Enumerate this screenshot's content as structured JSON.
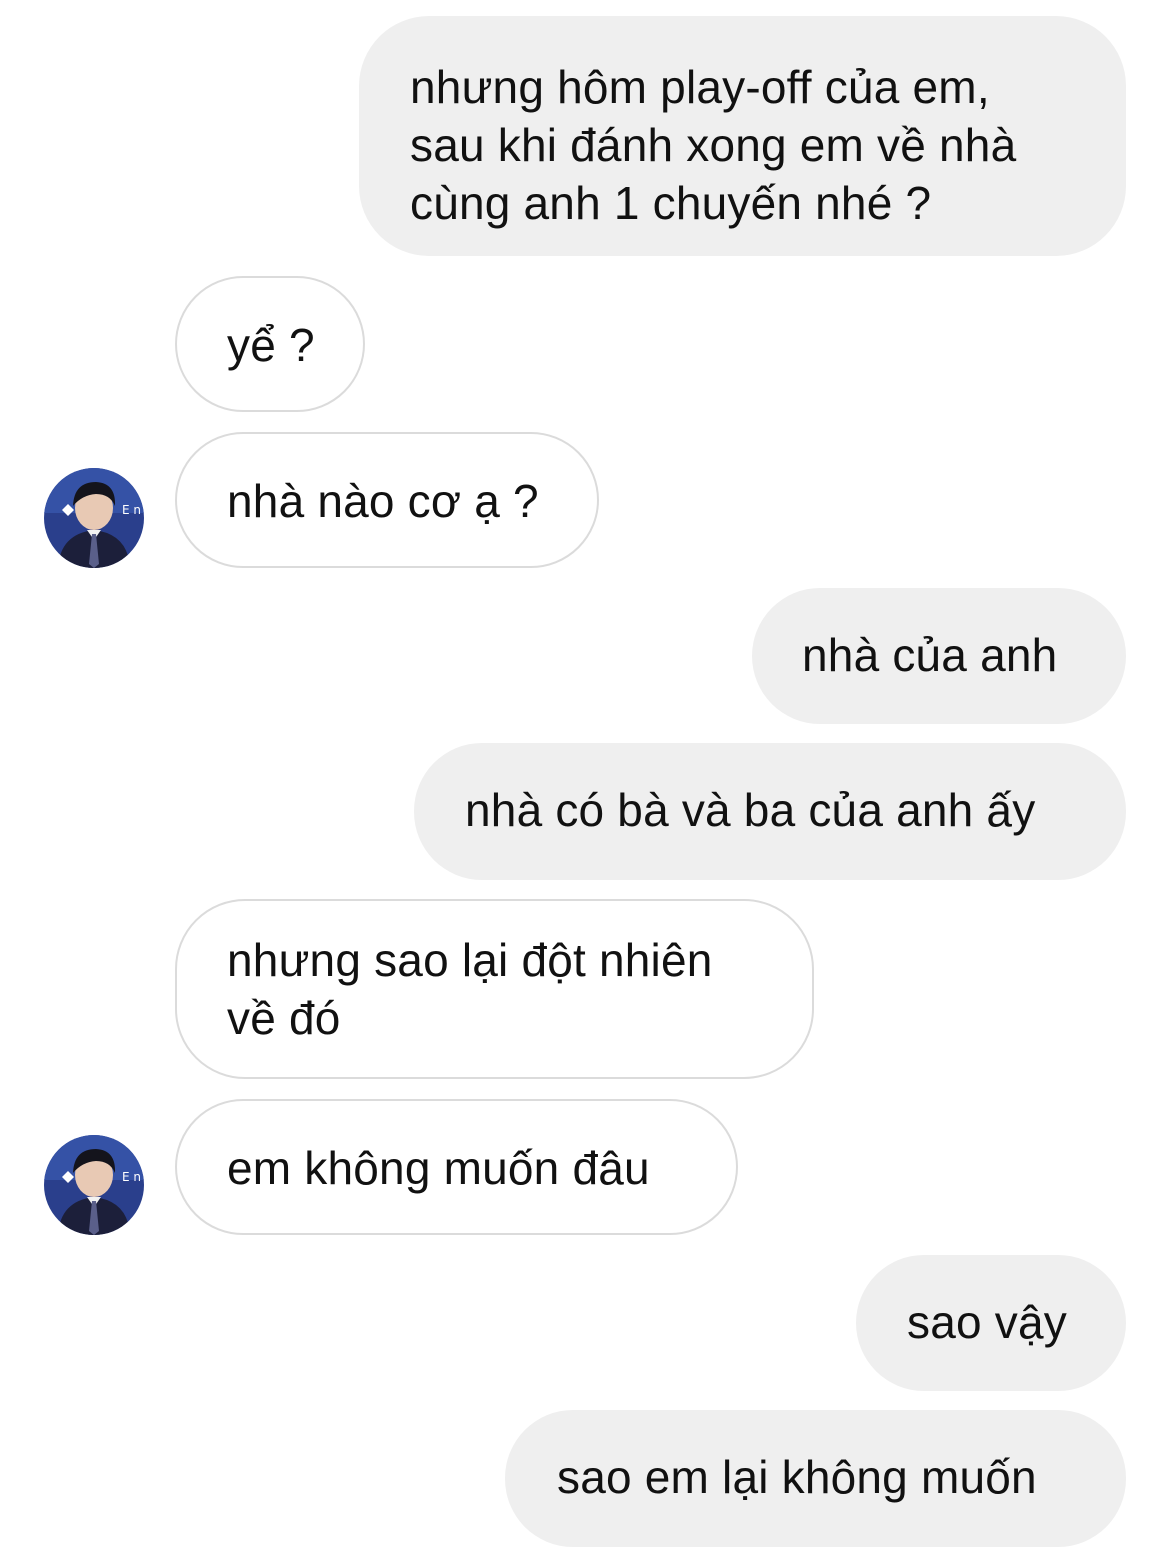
{
  "messages": [
    {
      "sender": "me",
      "text": "nhưng hôm play-off của em,\nsau khi đánh xong em về nhà\ncùng anh 1 chuyến nhé ?"
    },
    {
      "sender": "other",
      "text": "yể ?"
    },
    {
      "sender": "other",
      "text": "nhà nào cơ ạ ?",
      "avatar": "profile-photo"
    },
    {
      "sender": "me",
      "text": "nhà của anh"
    },
    {
      "sender": "me",
      "text": "nhà có bà và ba của anh ấy"
    },
    {
      "sender": "other",
      "text": "nhưng sao lại đột nhiên\nvề đó"
    },
    {
      "sender": "other",
      "text": "em không muốn đâu",
      "avatar": "profile-photo"
    },
    {
      "sender": "me",
      "text": "sao vậy"
    },
    {
      "sender": "me",
      "text": "sao em lại không muốn"
    }
  ],
  "colors": {
    "sent_bubble": "#efefef",
    "received_border": "#dbdbdb",
    "text": "#111111",
    "background": "#ffffff"
  }
}
